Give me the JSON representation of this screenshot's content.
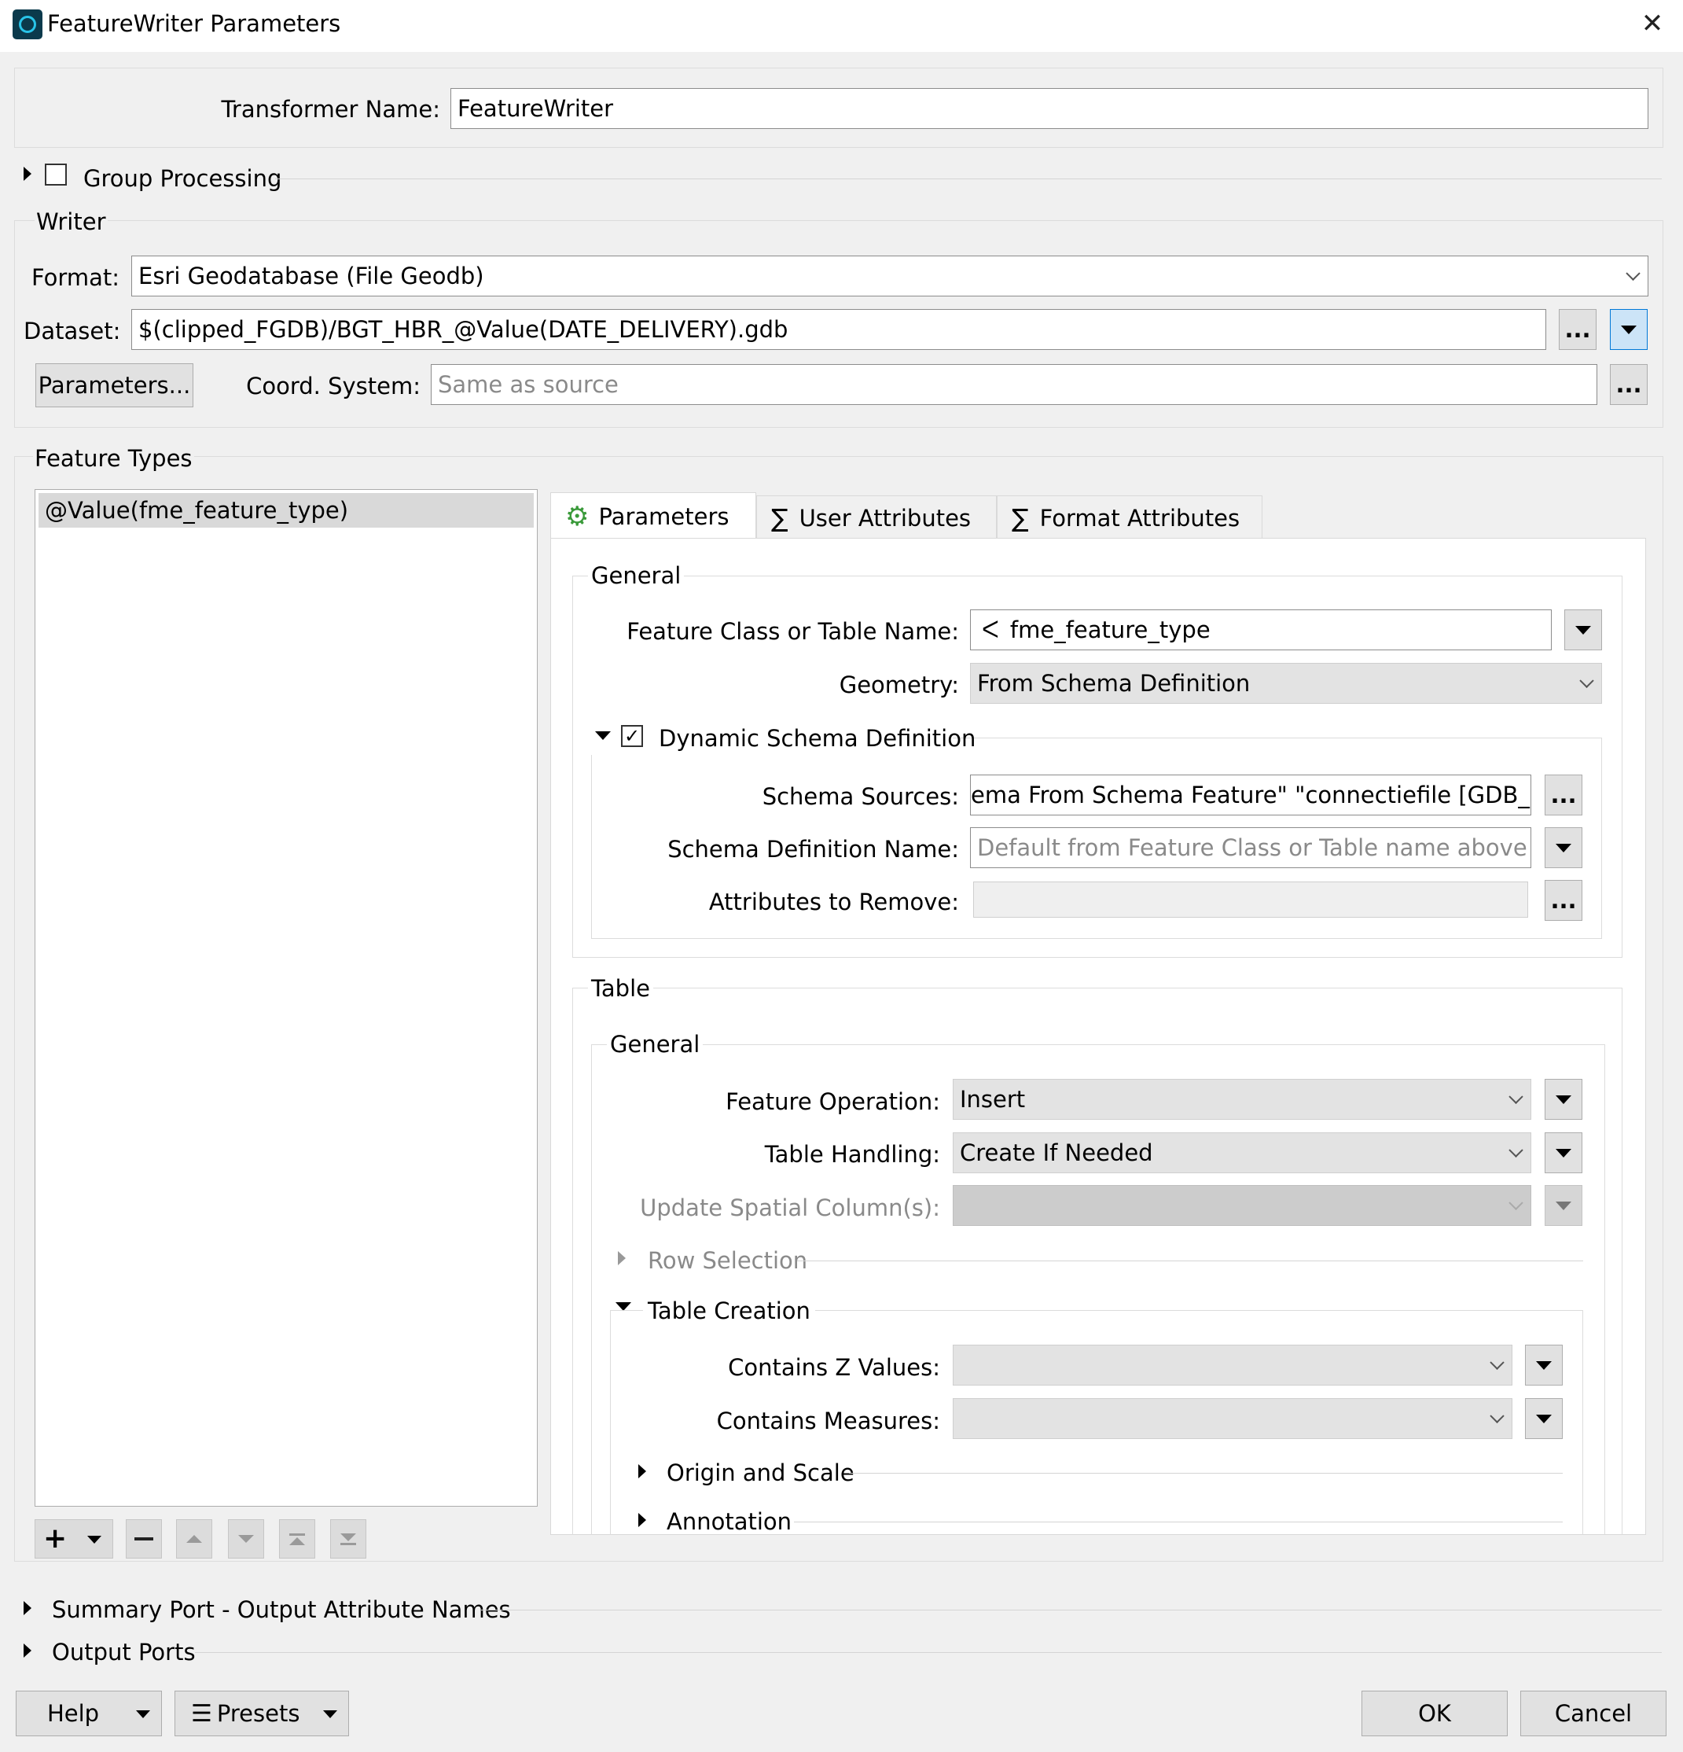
{
  "window": {
    "title": "FeatureWriter Parameters"
  },
  "transformer": {
    "label": "Transformer Name:",
    "value": "FeatureWriter"
  },
  "group_processing": {
    "label": "Group Processing",
    "checked": false
  },
  "writer": {
    "heading": "Writer",
    "format_label": "Format:",
    "format_value": "Esri Geodatabase (File Geodb)",
    "dataset_label": "Dataset:",
    "dataset_value": "$(clipped_FGDB)/BGT_HBR_@Value(DATE_DELIVERY).gdb",
    "ellipsis": "...",
    "parameters_button": "Parameters...",
    "coord_label": "Coord. System:",
    "coord_placeholder": "Same as source"
  },
  "feature_types": {
    "heading": "Feature Types",
    "items": [
      "@Value(fme_feature_type)"
    ]
  },
  "tabs": [
    {
      "label": "Parameters",
      "icon": "gear-icon",
      "active": true
    },
    {
      "label": "User Attributes",
      "icon": "sigma-icon",
      "active": false
    },
    {
      "label": "Format Attributes",
      "icon": "sigma-icon",
      "active": false
    }
  ],
  "general": {
    "heading": "General",
    "feature_class_label": "Feature Class or Table Name:",
    "feature_class_value": "fme_feature_type",
    "geometry_label": "Geometry:",
    "geometry_value": "From Schema Definition"
  },
  "dynamic_schema": {
    "label": "Dynamic Schema Definition",
    "checked": true,
    "sources_label": "Schema Sources:",
    "sources_value": "ema From Schema Feature\" \"connectiefile [GDB_SDE]\"",
    "def_name_label": "Schema Definition Name:",
    "def_name_placeholder": "Default from Feature Class or Table name above",
    "remove_label": "Attributes to Remove:",
    "remove_value": ""
  },
  "table": {
    "heading": "Table",
    "general_heading": "General",
    "operation_label": "Feature Operation:",
    "operation_value": "Insert",
    "handling_label": "Table Handling:",
    "handling_value": "Create If Needed",
    "spatial_label": "Update Spatial Column(s):",
    "spatial_value": "",
    "row_selection": "Row Selection",
    "table_creation": "Table Creation",
    "z_label": "Contains Z Values:",
    "z_value": "",
    "measures_label": "Contains Measures:",
    "measures_value": "",
    "origin_scale": "Origin and Scale",
    "annotation": "Annotation"
  },
  "sections": {
    "summary_port": "Summary Port - Output Attribute Names",
    "output_ports": "Output Ports"
  },
  "footer": {
    "help": "Help",
    "presets": "Presets",
    "ok": "OK",
    "cancel": "Cancel"
  }
}
